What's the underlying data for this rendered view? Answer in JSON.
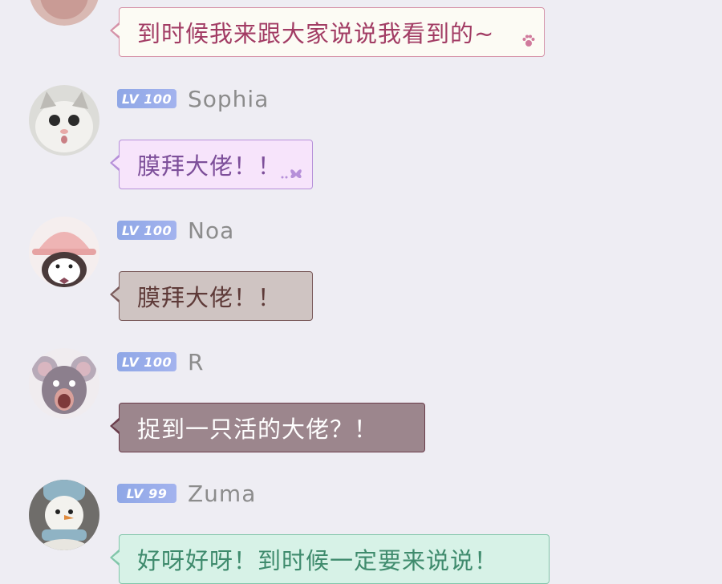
{
  "messages": [
    {
      "user": null,
      "level": null,
      "text": "到时候我来跟大家说说我看到的~",
      "bubble_bg": "#fcfbf4",
      "bubble_border": "#d592a8",
      "text_color": "#a23c64",
      "deco": "paw-icon"
    },
    {
      "user": "Sophia",
      "level": "LV 100",
      "text": "膜拜大佬！！",
      "bubble_bg": "#f7e4fb",
      "bubble_border": "#b690d9",
      "text_color": "#7d4f9a",
      "deco": "butterfly-icon"
    },
    {
      "user": "Noa",
      "level": "LV 100",
      "text": "膜拜大佬！！",
      "bubble_bg": "#cfc4c2",
      "bubble_border": "#7a5a5a",
      "text_color": "#5e3a38",
      "deco": null
    },
    {
      "user": "R",
      "level": "LV 100",
      "text": "捉到一只活的大佬？！",
      "bubble_bg": "#9c868d",
      "bubble_border": "#6a3c4a",
      "text_color": "#ffffff",
      "deco": null
    },
    {
      "user": "Zuma",
      "level": "LV 99",
      "text": "好呀好呀！到时候一定要来说说！",
      "bubble_bg": "#d7f2e7",
      "bubble_border": "#82c6aa",
      "text_color": "#3f8b6d",
      "deco": null
    }
  ]
}
